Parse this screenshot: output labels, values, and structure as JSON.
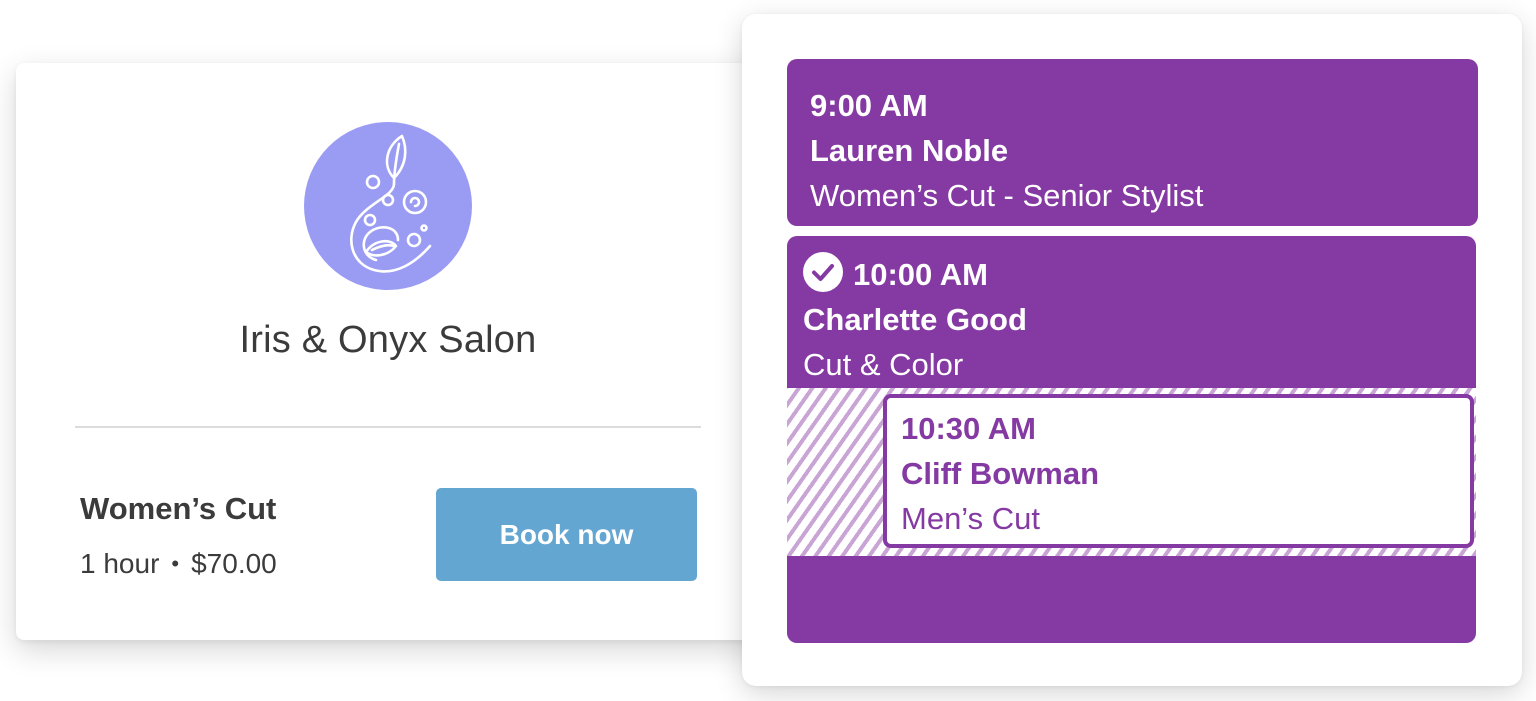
{
  "salon": {
    "name": "Iris & Onyx Salon",
    "logo_icon": "leaf-swirl-logo",
    "logo_color": "#9a9cf4"
  },
  "service": {
    "name": "Women’s Cut",
    "duration": "1 hour",
    "separator": "•",
    "price": "$70.00"
  },
  "book_button": {
    "label": "Book now",
    "color": "#64a6d2"
  },
  "schedule": {
    "accent_color": "#8539a2",
    "appointments": [
      {
        "time": "9:00 AM",
        "client": "Lauren Noble",
        "service": "Women’s Cut - Senior Stylist"
      },
      {
        "time": "10:00 AM",
        "client": "Charlette Good",
        "service": "Cut & Color",
        "status_icon": "check-circle-icon"
      },
      {
        "time": "10:30 AM",
        "client": "Cliff Bowman",
        "service": "Men’s Cut"
      }
    ]
  }
}
